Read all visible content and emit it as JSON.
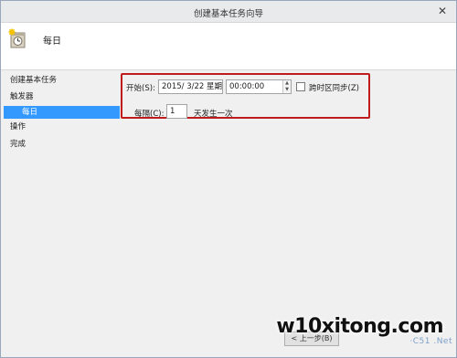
{
  "window": {
    "title": "创建基本任务向导",
    "close_glyph": "✕"
  },
  "header": {
    "title": "每日",
    "icon": "task-scheduler-icon"
  },
  "sidebar": {
    "items": [
      {
        "label": "创建基本任务"
      },
      {
        "label": "触发器"
      },
      {
        "label": "每日"
      },
      {
        "label": "操作"
      },
      {
        "label": "完成"
      }
    ],
    "active_index": 2,
    "active_color": "#3399ff"
  },
  "form": {
    "start_label": "开始(S):",
    "date_value": "2015/  3/22 星期",
    "time_value": "00:00:00",
    "sync_label": "跨时区同步(Z)",
    "sync_checked": false,
    "recur_label": "每隔(C):",
    "recur_value": "1",
    "recur_suffix": "天发生一次"
  },
  "highlight_color": "#c01b1b",
  "footer": {
    "back_button_label": "< 上一步(B)",
    "watermark": "w10xitong.com",
    "watermark2": "·C51 .Net"
  }
}
